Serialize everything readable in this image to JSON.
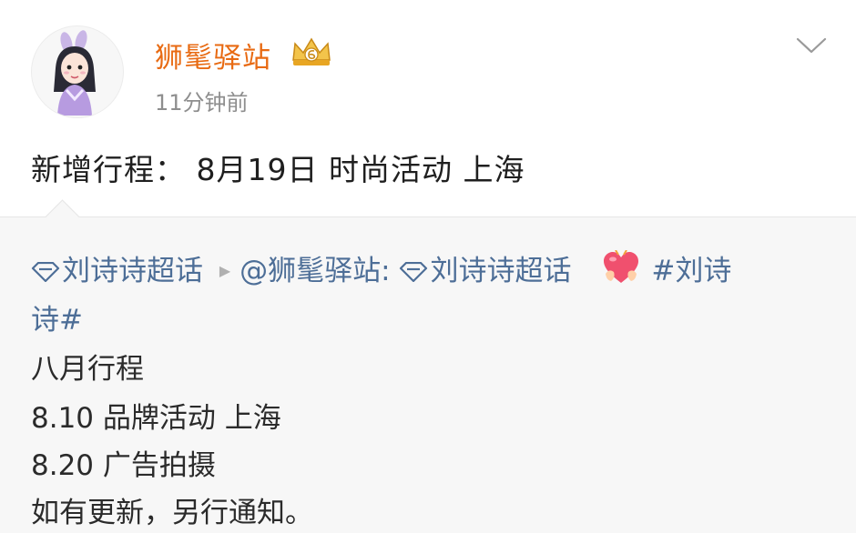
{
  "colors": {
    "username": "#e86a12",
    "link": "#4d6e97",
    "repost_bg": "#f7f7f7",
    "timestamp": "#8e8e8e"
  },
  "post": {
    "author": "狮髦驿站",
    "timestamp": "11分钟前",
    "text": "新增行程： 8月19日 时尚活动 上海",
    "menu_icon": "chevron-down-icon",
    "badge_icon": "crown-vip-badge-icon"
  },
  "repost": {
    "topic_tag": "刘诗诗超话",
    "mention": "@狮髦驿站",
    "mention_colon": ":",
    "inner_topic_tag": "刘诗诗超话",
    "hashtag_part1": "#刘诗",
    "hashtag_part2": "诗#",
    "heart_icon": "heart-hug-emoji-icon",
    "lines": [
      "八月行程",
      "8.10 品牌活动 上海",
      "8.20 广告拍摄",
      "如有更新，另行通知。"
    ]
  }
}
